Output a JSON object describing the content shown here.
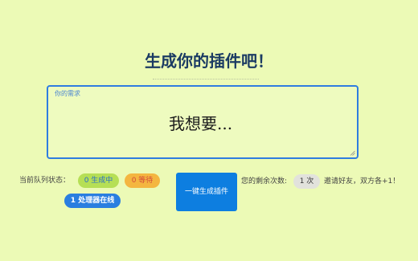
{
  "header": {
    "title": "生成你的插件吧！"
  },
  "request": {
    "label": "你的需求",
    "placeholder": "我想要..."
  },
  "queue": {
    "label": "当前队列状态：",
    "generating": "0 生成中",
    "waiting": "0 等待",
    "workers": "1 处理器在线"
  },
  "actions": {
    "generate_label": "一键生成插件"
  },
  "quota": {
    "label": "您的剩余次数:",
    "count": "1 次",
    "invite": "邀请好友，双方各+1！"
  },
  "colors": {
    "background": "#ecfab6",
    "accent": "#0d7ee0",
    "title": "#1b3b63",
    "generating_pill": "#b6df55",
    "waiting_pill": "#f4b640"
  }
}
